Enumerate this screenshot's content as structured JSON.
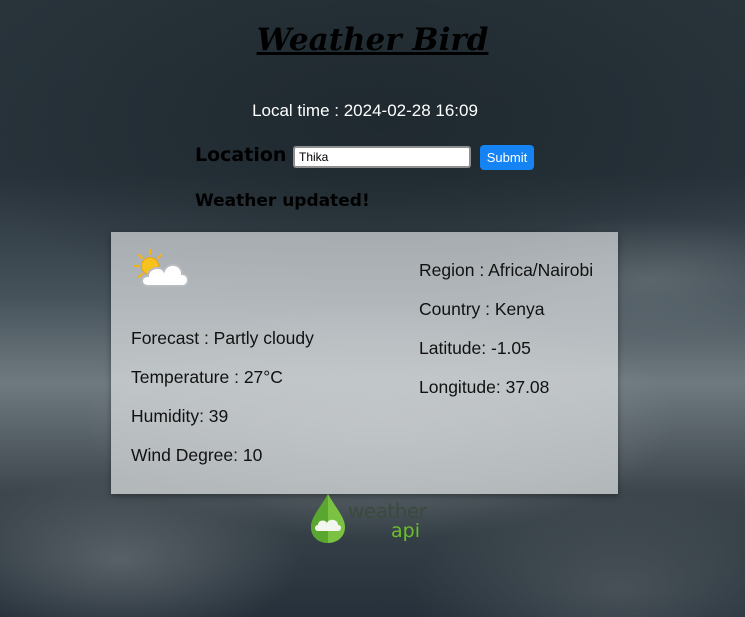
{
  "header": {
    "title": "Weather Bird",
    "local_time": "Local time : 2024-02-28 16:09"
  },
  "search": {
    "label": "Location",
    "value": "Thika",
    "placeholder": "",
    "submit_label": "Submit"
  },
  "status": {
    "message": "Weather updated!"
  },
  "weather": {
    "icon": "partly-cloudy-icon",
    "forecast": "Forecast : Partly cloudy",
    "temperature": "Temperature : 27°C",
    "humidity": "Humidity: 39",
    "wind_degree": "Wind Degree: 10",
    "region": "Region : Africa/Nairobi",
    "country": "Country : Kenya",
    "latitude": "Latitude: -1.05",
    "longitude": "Longitude: 37.08"
  },
  "footer": {
    "logo_word_1": "weather",
    "logo_word_2": "api"
  },
  "colors": {
    "submit_button": "#1683f5",
    "logo_green": "#6cbf2a"
  }
}
